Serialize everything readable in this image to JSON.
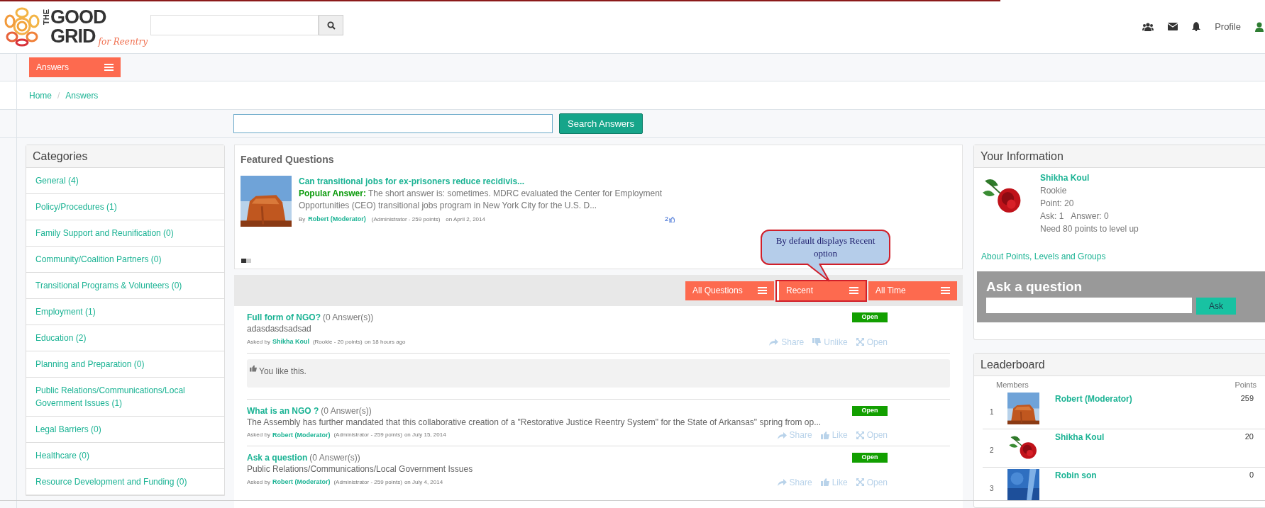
{
  "logo": {
    "the": "THE",
    "line1": "GOOD",
    "line2": "GRID",
    "tagline": "for Reentry"
  },
  "header": {
    "profile": "Profile"
  },
  "nav": {
    "menu_button": "Answers"
  },
  "breadcrumb": {
    "items": [
      "Home",
      "Answers"
    ],
    "separator": "/"
  },
  "answer_search": {
    "button": "Search Answers"
  },
  "categories": {
    "title": "Categories",
    "items": [
      {
        "label": "General (4)"
      },
      {
        "label": "Policy/Procedures (1)"
      },
      {
        "label": "Family Support and Reunification (0)"
      },
      {
        "label": "Community/Coalition Partners (0)"
      },
      {
        "label": "Transitional Programs & Volunteers (0)"
      },
      {
        "label": "Employment (1)"
      },
      {
        "label": "Education (2)"
      },
      {
        "label": "Planning and Preparation (0)"
      },
      {
        "label": "Public Relations/Communications/Local Government Issues (1)"
      },
      {
        "label": "Legal Barriers (0)"
      },
      {
        "label": "Healthcare (0)"
      },
      {
        "label": "Resource Development and Funding (0)"
      }
    ]
  },
  "featured": {
    "title": "Featured Questions",
    "question": "Can transitional jobs for ex-prisoners reduce recidivis...",
    "answer_label": "Popular Answer:",
    "answer": "The short answer is: sometimes. MDRC evaluated the Center for Employment Opportunities (CEO) transitional jobs program in New York City for the U.S. D...",
    "by": "By",
    "author": "Robert (Moderator)",
    "role": "(Administrator - 259 points)",
    "date": "on April 2, 2014",
    "likes": "2",
    "slides": [
      {
        "selected": true
      },
      {
        "selected": false
      }
    ]
  },
  "callout": "By default displays Recent option",
  "filters": [
    {
      "label": "All Questions",
      "selected": false
    },
    {
      "label": "Recent",
      "selected": true
    },
    {
      "label": "All Time",
      "selected": false
    }
  ],
  "questions": [
    {
      "title": "Full form of NGO?",
      "answers": "(0 Answer(s))",
      "body": "adasdasdsadsad",
      "asked_by": "Asked by",
      "author": "Shikha Koul",
      "role": "(Rookie - 20 points)",
      "time": "on 18 hours ago",
      "status": "Open",
      "actions": [
        {
          "kind": "share",
          "label": "Share"
        },
        {
          "kind": "unlike",
          "label": "Unlike"
        },
        {
          "kind": "open",
          "label": "Open"
        }
      ],
      "liked_note": "You like this."
    },
    {
      "title": "What is an NGO ?",
      "answers": "(0 Answer(s))",
      "body": "The Assembly has further mandated that this collaborative creation of a \"Restorative Justice Reentry System\" for the State of Arkansas\" spring from op...",
      "asked_by": "Asked by",
      "author": "Robert (Moderator)",
      "role": "(Administrator - 259 points)",
      "time": "on July 15, 2014",
      "status": "Open",
      "actions": [
        {
          "kind": "share",
          "label": "Share"
        },
        {
          "kind": "like",
          "label": "Like"
        },
        {
          "kind": "open",
          "label": "Open"
        }
      ]
    },
    {
      "title": "Ask a question",
      "answers": "(0 Answer(s))",
      "body": "Public Relations/Communications/Local Government Issues",
      "asked_by": "Asked by",
      "author": "Robert (Moderator)",
      "role": "(Administrator - 259 points)",
      "time": "on July 4, 2014",
      "status": "Open",
      "actions": [
        {
          "kind": "share",
          "label": "Share"
        },
        {
          "kind": "like",
          "label": "Like"
        },
        {
          "kind": "open",
          "label": "Open"
        }
      ]
    }
  ],
  "your_information": {
    "title": "Your Information",
    "name": "Shikha Koul",
    "level": "Rookie",
    "points": "Point: 20",
    "ask": "Ask: 1",
    "answer": "Answer: 0",
    "need": "Need 80 points to level up",
    "about_link": "About Points, Levels and Groups"
  },
  "ask_box": {
    "title": "Ask a question",
    "button": "Ask"
  },
  "leaderboard": {
    "title": "Leaderboard",
    "columns": [
      "Members",
      "Points"
    ],
    "rows": [
      {
        "rank": "1",
        "name": "Robert (Moderator)",
        "points": "259"
      },
      {
        "rank": "2",
        "name": "Shikha Koul",
        "points": "20"
      },
      {
        "rank": "3",
        "name": "Robin son",
        "points": "0"
      }
    ]
  }
}
